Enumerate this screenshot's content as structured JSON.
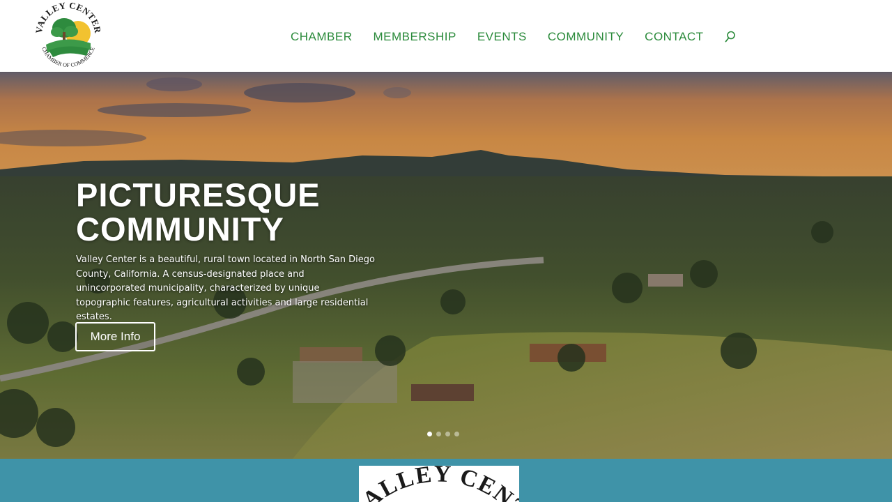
{
  "site": {
    "logo_text_top": "VALLEY CENTER",
    "logo_text_bottom": "CHAMBER OF COMMERCE"
  },
  "nav": {
    "items": [
      {
        "label": "CHAMBER"
      },
      {
        "label": "MEMBERSHIP"
      },
      {
        "label": "EVENTS"
      },
      {
        "label": "COMMUNITY"
      },
      {
        "label": "CONTACT"
      }
    ]
  },
  "hero": {
    "title": "PICTURESQUE COMMUNITY",
    "description": "Valley Center is a beautiful, rural town located in North San Diego County, California. A census-designated place and unincorporated municipality, characterized by unique topographic features, agricultural activities and large residential estates.",
    "button_label": "More Info",
    "slides": 4,
    "active_slide": 1
  },
  "section2": {
    "logo_text": "VALLEY CENT"
  },
  "colors": {
    "nav_green": "#2a8a3a",
    "teal": "#3f93a8",
    "logo_green": "#2e8b3e",
    "logo_yellow": "#f2c230"
  },
  "icons": {
    "search": "search-icon"
  }
}
